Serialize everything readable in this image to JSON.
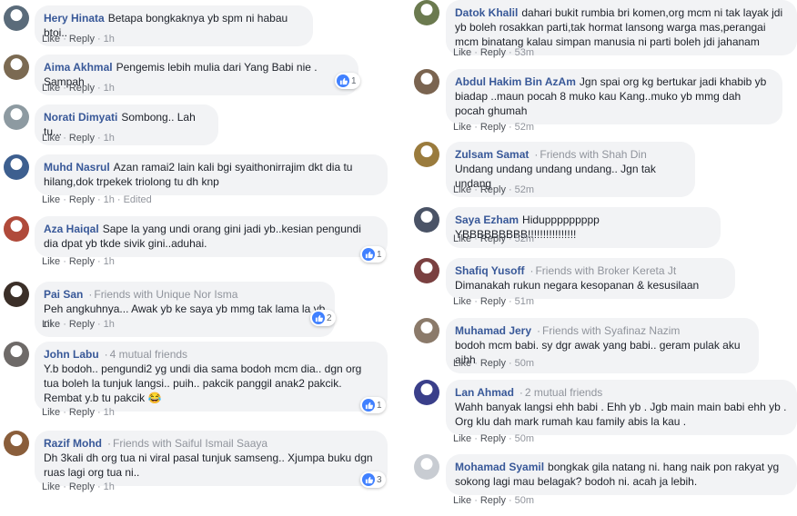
{
  "labels": {
    "like": "Like",
    "reply": "Reply",
    "edited": "Edited",
    "dot": "·"
  },
  "colors": {
    "name": "#385898",
    "bubble": "#f2f3f5",
    "like_badge": "#4080ff"
  },
  "left": [
    {
      "name": "Hery Hinata",
      "subtitle": "",
      "text": "Betapa bongkaknya yb spm ni habau btoi..",
      "time": "1h",
      "edited": false,
      "reactions": ""
    },
    {
      "name": "Aima Akhmal",
      "subtitle": "",
      "text": "Pengemis lebih mulia dari Yang Babi nie . Sampah",
      "time": "1h",
      "edited": false,
      "reactions": "1"
    },
    {
      "name": "Norati Dimyati",
      "subtitle": "",
      "text": "Sombong.. Lah tu...",
      "time": "1h",
      "edited": false,
      "reactions": ""
    },
    {
      "name": "Muhd Nasrul",
      "subtitle": "",
      "text": "Azan ramai2 lain kali bgi syaithonirrajim dkt dia tu hilang,dok trpekek triolong tu dh knp",
      "time": "1h",
      "edited": true,
      "reactions": ""
    },
    {
      "name": "Aza Haiqal",
      "subtitle": "",
      "text": "Sape la yang undi orang gini jadi yb..kesian pengundi dia dpat yb tkde sivik gini..aduhai.",
      "time": "1h",
      "edited": false,
      "reactions": "1"
    },
    {
      "name": "Pai San",
      "subtitle": "Friends with Unique Nor Isma",
      "text": "Peh angkuhnya... Awak yb ke saya yb mmg tak lama la yb ni",
      "time": "1h",
      "edited": false,
      "reactions": "2"
    },
    {
      "name": "John Labu",
      "subtitle": "4 mutual friends",
      "text": "Y.b bodoh.. pengundi2 yg undi dia sama bodoh mcm dia.. dgn org tua boleh la tunjuk langsi.. puih.. pakcik panggil anak2 pakcik. Rembat y.b tu pakcik 😂",
      "time": "1h",
      "edited": false,
      "reactions": "1"
    },
    {
      "name": "Razif Mohd",
      "subtitle": "Friends with Saiful Ismail Saaya",
      "text": "Dh 3kali dh org tua ni viral pasal tunjuk samseng.. Xjumpa buku dgn ruas lagi org tua ni..",
      "time": "1h",
      "edited": false,
      "reactions": "3"
    }
  ],
  "right": [
    {
      "name": "Datok Khalil",
      "subtitle": "",
      "text": "dahari bukit rumbia bri komen,org mcm ni tak layak jdi yb boleh rosakkan parti,tak hormat lansong warga mas,perangai mcm binatang kalau simpan manusia ni parti boleh jdi jahanam",
      "time": "53m",
      "edited": false,
      "reactions": ""
    },
    {
      "name": "Abdul Hakim Bin AzAm",
      "subtitle": "",
      "text": "Jgn spai org kg bertukar jadi khabib yb biadap ..maun pocah 8 muko kau Kang..muko yb mmg dah pocah ghumah",
      "time": "52m",
      "edited": false,
      "reactions": ""
    },
    {
      "name": "Zulsam Samat",
      "subtitle": "Friends with Shah Din",
      "text": "Undang undang undang undang.. Jgn tak undang",
      "time": "52m",
      "edited": false,
      "reactions": ""
    },
    {
      "name": "Saya Ezham",
      "subtitle": "",
      "text": "Hiduppppppppp YBBBBBBBBB!!!!!!!!!!!!!!!!",
      "time": "52m",
      "edited": false,
      "reactions": ""
    },
    {
      "name": "Shafiq Yusoff",
      "subtitle": "Friends with Broker Kereta Jt",
      "text": "Dimanakah rukun negara kesopanan & kesusilaan",
      "time": "51m",
      "edited": false,
      "reactions": ""
    },
    {
      "name": "Muhamad Jery",
      "subtitle": "Friends with Syafinaz Nazim",
      "text": "bodoh mcm babi. sy dgr awak yang babi.. geram pulak aku aihh",
      "time": "50m",
      "edited": false,
      "reactions": ""
    },
    {
      "name": "Lan Ahmad",
      "subtitle": "2 mutual friends",
      "text": "Wahh banyak langsi ehh babi . Ehh yb . Jgb main main babi ehh yb . Org klu dah mark rumah kau family abis la kau .",
      "time": "50m",
      "edited": false,
      "reactions": ""
    },
    {
      "name": "Mohamad Syamil",
      "subtitle": "",
      "text": "bongkak gila natang ni. hang naik pon rakyat yg sokong lagi mau belagak? bodoh ni. acah ja lebih.",
      "time": "50m",
      "edited": false,
      "reactions": ""
    }
  ]
}
